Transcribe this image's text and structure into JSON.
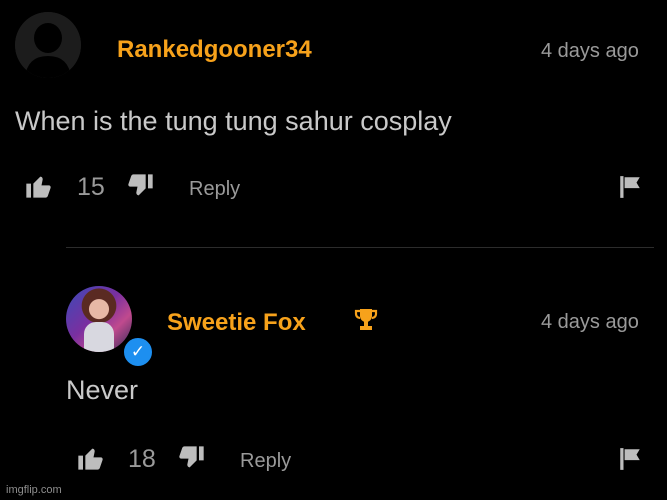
{
  "comments": [
    {
      "username": "Rankedgooner34",
      "time": "4 days ago",
      "text": "When is the tung tung sahur cosplay",
      "likes": "15",
      "reply_label": "Reply"
    },
    {
      "username": "Sweetie Fox",
      "time": "4 days ago",
      "text": "Never",
      "likes": "18",
      "reply_label": "Reply"
    }
  ],
  "watermark": "imgflip.com",
  "icons": {
    "like": "thumbs-up-icon",
    "dislike": "thumbs-down-icon",
    "flag": "flag-icon",
    "trophy": "trophy-icon",
    "verified": "verified-badge-icon"
  },
  "colors": {
    "username": "#f7a21b",
    "verified": "#1d8ff0",
    "background": "#000000"
  }
}
